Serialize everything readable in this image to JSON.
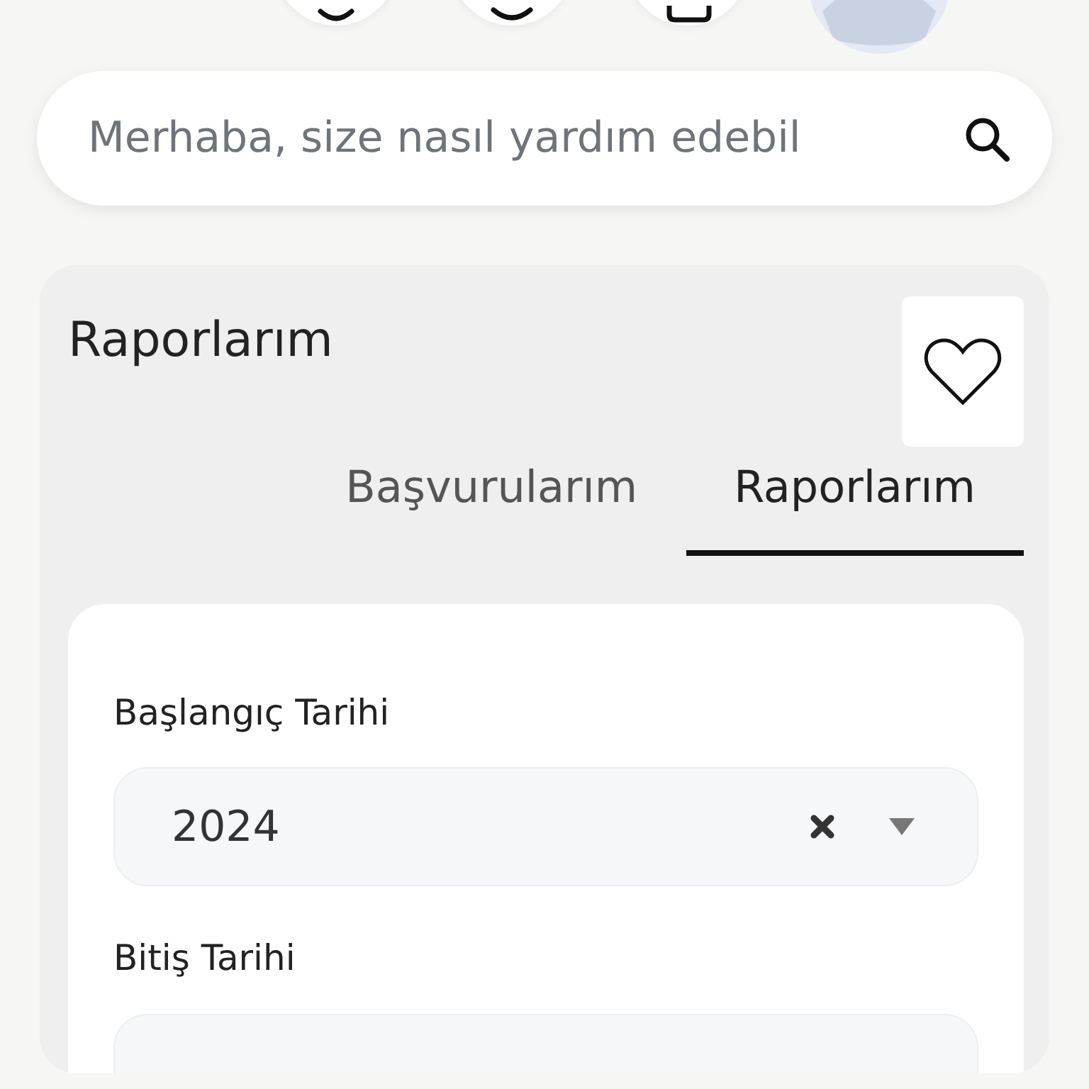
{
  "top_buttons": [
    {
      "kind": "icon"
    },
    {
      "kind": "icon"
    },
    {
      "kind": "icon"
    },
    {
      "kind": "avatar"
    }
  ],
  "search": {
    "placeholder": "Merhaba, size nasıl yardım edebil"
  },
  "panel": {
    "title": "Raporlarım",
    "favorite": false,
    "tabs": [
      {
        "label": "Başvurularım",
        "selected": false
      },
      {
        "label": "Raporlarım",
        "selected": true
      }
    ],
    "fields": [
      {
        "label": "Başlangıç Tarihi",
        "value": "2024"
      },
      {
        "label": "Bitiş Tarihi"
      }
    ]
  }
}
